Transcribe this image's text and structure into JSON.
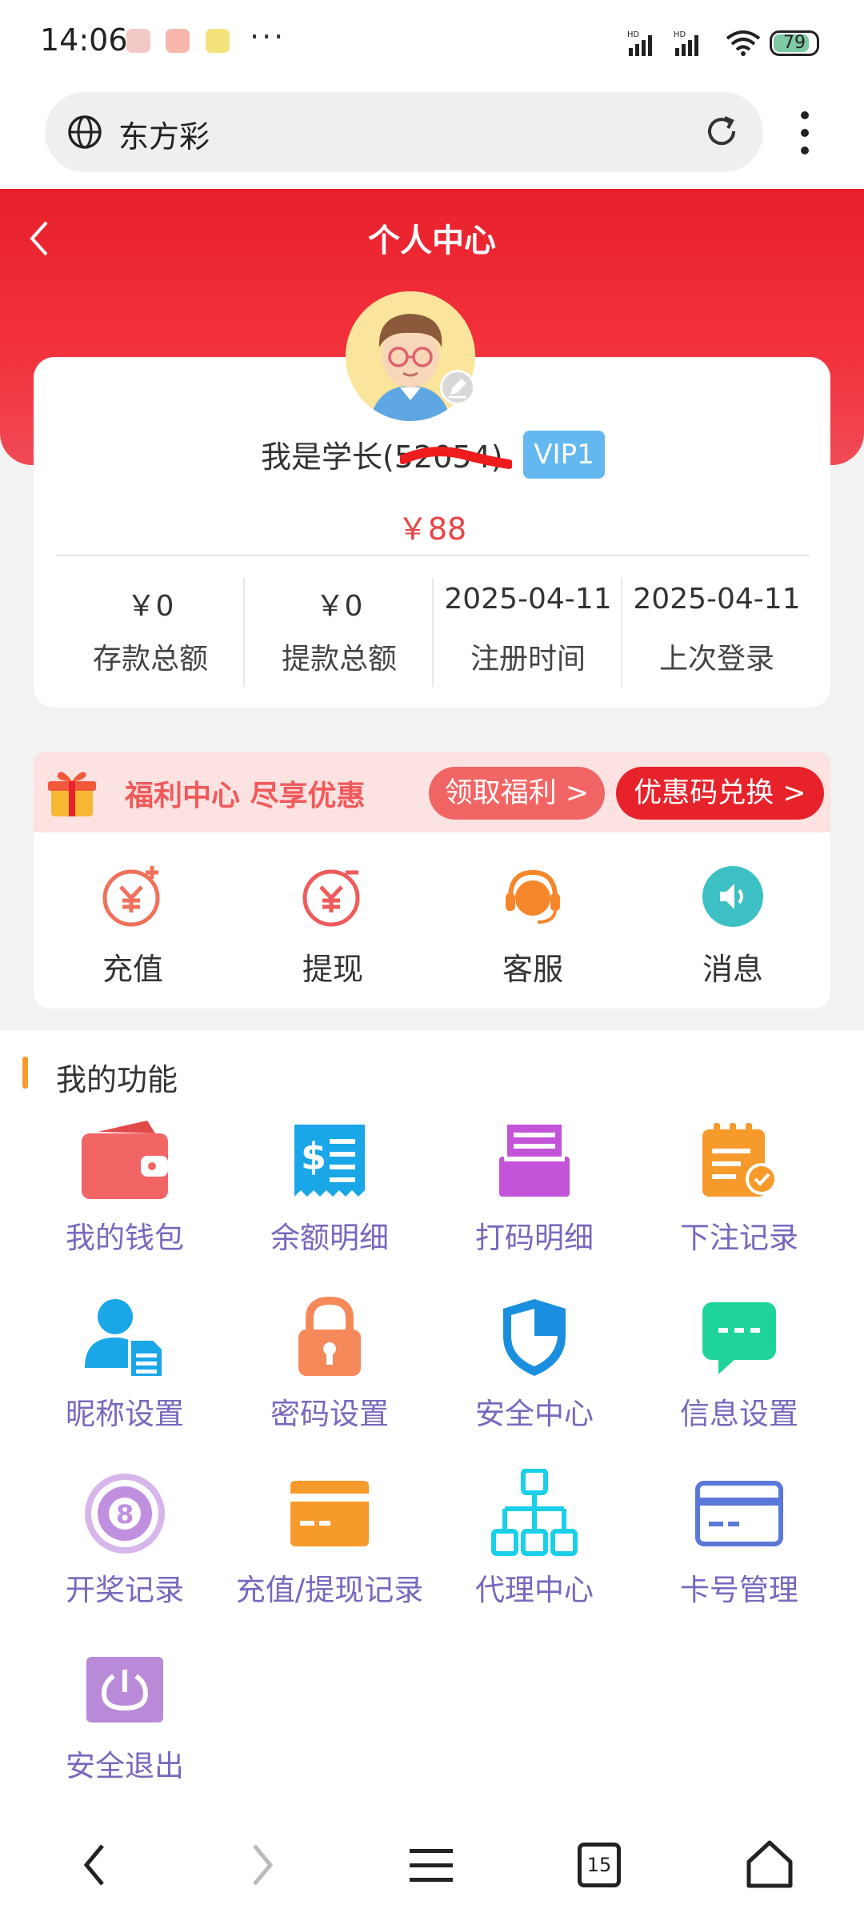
{
  "status_bar": {
    "time": "14:06",
    "more": "···",
    "signal1": "HD",
    "signal2": "HD",
    "battery": "79"
  },
  "browser": {
    "url_text": "东方彩",
    "reload_icon": "reload-icon",
    "menu_icon": "more-vert-icon"
  },
  "header": {
    "title": "个人中心",
    "back_icon": "chevron-left-icon"
  },
  "profile": {
    "name": "我是学长(52",
    "name_tail": "054)",
    "vip": "VIP1",
    "balance": "￥88",
    "stats": [
      {
        "value": "￥0",
        "label": "存款总额"
      },
      {
        "value": "￥0",
        "label": "提款总额"
      },
      {
        "value": "2025-04-11",
        "label": "注册时间"
      },
      {
        "value": "2025-04-11",
        "label": "上次登录"
      }
    ]
  },
  "promo": {
    "text": "福利中心 尽享优惠",
    "btn1": "领取福利 >",
    "btn2": "优惠码兑换 >"
  },
  "quick_actions": [
    {
      "label": "充值",
      "icon": "deposit-icon",
      "color": "#f0705a"
    },
    {
      "label": "提现",
      "icon": "withdraw-icon",
      "color": "#ef5a5a"
    },
    {
      "label": "客服",
      "icon": "customer-service-icon",
      "color": "#f5862a"
    },
    {
      "label": "消息",
      "icon": "speaker-icon",
      "color": "#3cc0c4"
    }
  ],
  "features": {
    "title": "我的功能",
    "items": [
      {
        "label": "我的钱包",
        "icon": "wallet-icon"
      },
      {
        "label": "余额明细",
        "icon": "receipt-icon"
      },
      {
        "label": "打码明细",
        "icon": "printer-icon"
      },
      {
        "label": "下注记录",
        "icon": "clipboard-check-icon"
      },
      {
        "label": "昵称设置",
        "icon": "user-doc-icon"
      },
      {
        "label": "密码设置",
        "icon": "lock-icon"
      },
      {
        "label": "安全中心",
        "icon": "shield-icon"
      },
      {
        "label": "信息设置",
        "icon": "chat-icon"
      },
      {
        "label": "开奖记录",
        "icon": "ball-8-icon"
      },
      {
        "label": "充值/提现记录",
        "icon": "card-icon"
      },
      {
        "label": "代理中心",
        "icon": "org-chart-icon"
      },
      {
        "label": "卡号管理",
        "icon": "credit-card-icon"
      },
      {
        "label": "安全退出",
        "icon": "power-icon"
      }
    ]
  },
  "nav": {
    "tabs_count": "15"
  }
}
